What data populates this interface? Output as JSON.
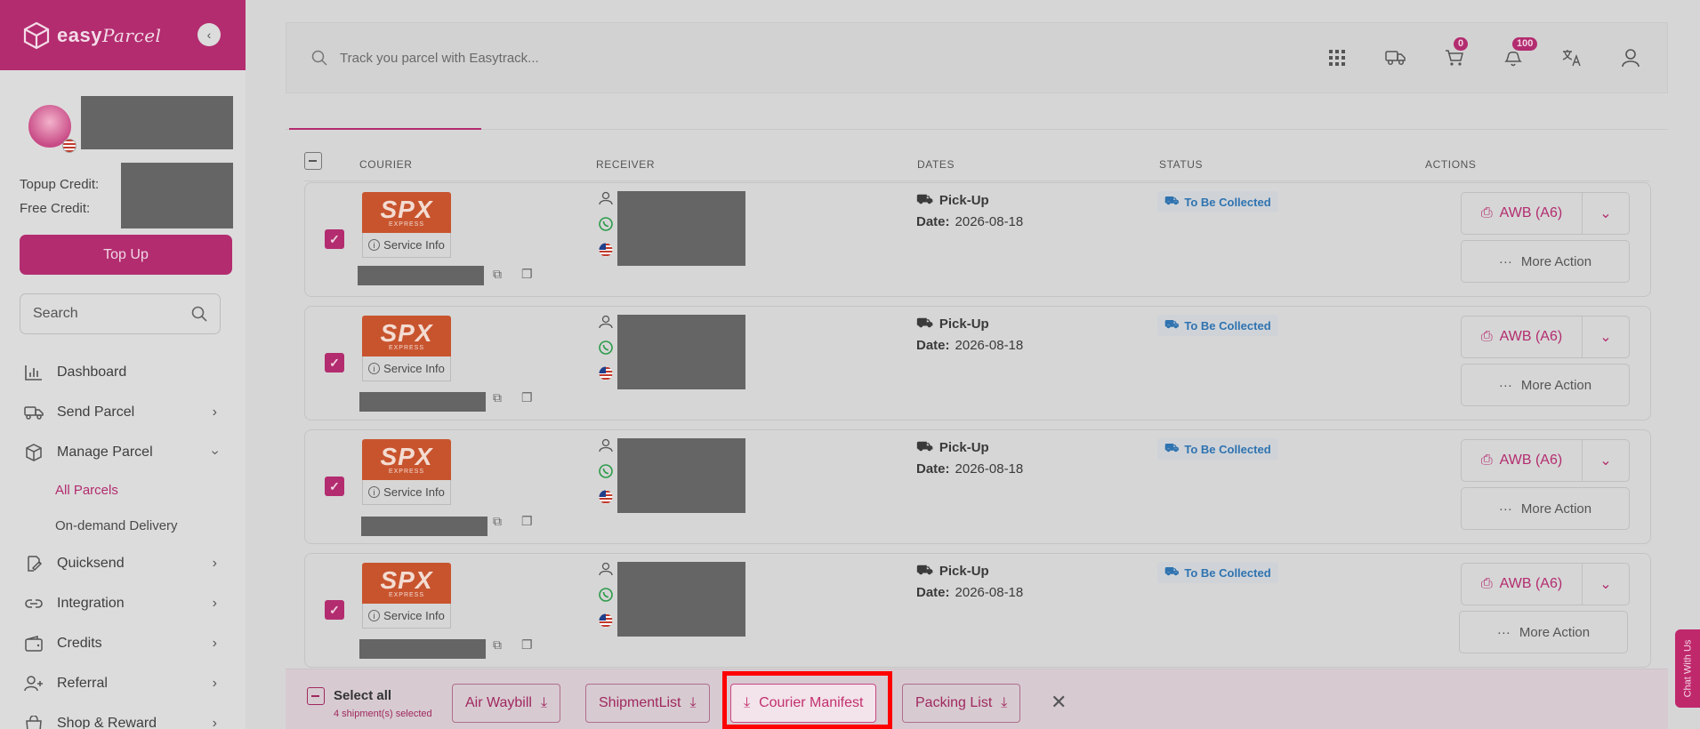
{
  "brand": {
    "name": "easy",
    "name_suffix": "Parcel"
  },
  "sidebar": {
    "topup_credit_label": "Topup Credit:",
    "free_credit_label": "Free Credit:",
    "topup_button": "Top Up",
    "search_placeholder": "Search",
    "items": [
      {
        "label": "Dashboard",
        "icon": "chart-icon",
        "has_chevron": false
      },
      {
        "label": "Send Parcel",
        "icon": "truck-icon",
        "has_chevron": true
      },
      {
        "label": "Manage Parcel",
        "icon": "box-icon",
        "has_chevron": true,
        "expanded": true
      },
      {
        "label": "Quicksend",
        "icon": "quicksend-icon",
        "has_chevron": true
      },
      {
        "label": "Integration",
        "icon": "link-icon",
        "has_chevron": true
      },
      {
        "label": "Credits",
        "icon": "wallet-icon",
        "has_chevron": true
      },
      {
        "label": "Referral",
        "icon": "user-plus-icon",
        "has_chevron": true
      },
      {
        "label": "Shop & Reward",
        "icon": "shop-icon",
        "has_chevron": true
      }
    ],
    "sub_items": [
      {
        "label": "All Parcels",
        "active": true
      },
      {
        "label": "On-demand Delivery",
        "active": false
      }
    ]
  },
  "topbar": {
    "search_placeholder": "Track you parcel with Easytrack...",
    "cart_badge": "0",
    "notification_badge": "100"
  },
  "table": {
    "headers": [
      "COURIER",
      "RECEIVER",
      "DATES",
      "STATUS",
      "ACTIONS"
    ],
    "rows": [
      {
        "courier": "SPX",
        "courier_sub": "EXPRESS",
        "service_info": "Service Info",
        "date_type": "Pick-Up",
        "date_label": "Date:",
        "date": "2026-08-18",
        "status": "To Be Collected",
        "awb": "AWB (A6)",
        "more": "More Action"
      },
      {
        "courier": "SPX",
        "courier_sub": "EXPRESS",
        "service_info": "Service Info",
        "date_type": "Pick-Up",
        "date_label": "Date:",
        "date": "2026-08-18",
        "status": "To Be Collected",
        "awb": "AWB (A6)",
        "more": "More Action"
      },
      {
        "courier": "SPX",
        "courier_sub": "EXPRESS",
        "service_info": "Service Info",
        "date_type": "Pick-Up",
        "date_label": "Date:",
        "date": "2026-08-18",
        "status": "To Be Collected",
        "awb": "AWB (A6)",
        "more": "More Action"
      },
      {
        "courier": "SPX",
        "courier_sub": "EXPRESS",
        "service_info": "Service Info",
        "date_type": "Pick-Up",
        "date_label": "Date:",
        "date": "2026-08-18",
        "status": "To Be Collected",
        "awb": "AWB (A6)",
        "more": "More Action"
      }
    ]
  },
  "bottom_bar": {
    "select_all": "Select all",
    "selected_count": "4 shipment(s) selected",
    "buttons": [
      "Air Waybill",
      "ShipmentList",
      "Courier Manifest",
      "Packing List"
    ]
  },
  "chat_tab": "Chat With Us",
  "colors": {
    "accent": "#b32c6f",
    "status_blue": "#2f73b0",
    "highlight": "#ff0000"
  }
}
